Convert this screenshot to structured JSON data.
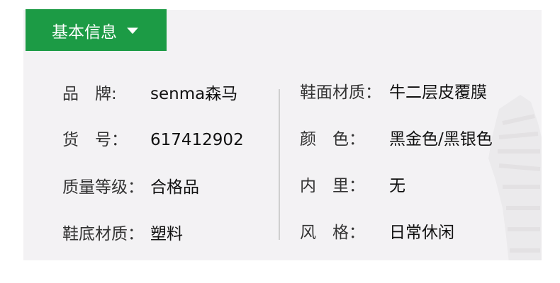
{
  "tab": {
    "label": "基本信息",
    "icon": "caret-down-icon"
  },
  "colors": {
    "tab_bg": "#1c9b45",
    "panel_bg": "#f3f2f4",
    "divider": "#cfcfcf"
  },
  "left_column": [
    {
      "label": "品　牌:",
      "value": "senma森马"
    },
    {
      "label": "货　号：",
      "value": "617412902"
    },
    {
      "label": "质量等级：",
      "value": "合格品"
    },
    {
      "label": "鞋底材质：",
      "value": "塑料"
    }
  ],
  "right_column": [
    {
      "label": "鞋面材质：",
      "value": "牛二层皮覆膜"
    },
    {
      "label": "颜　色：",
      "value": "黑金色/黑银色"
    },
    {
      "label": "内　里：",
      "value": "无"
    },
    {
      "label": "风　格：",
      "value": "日常休闲"
    }
  ]
}
